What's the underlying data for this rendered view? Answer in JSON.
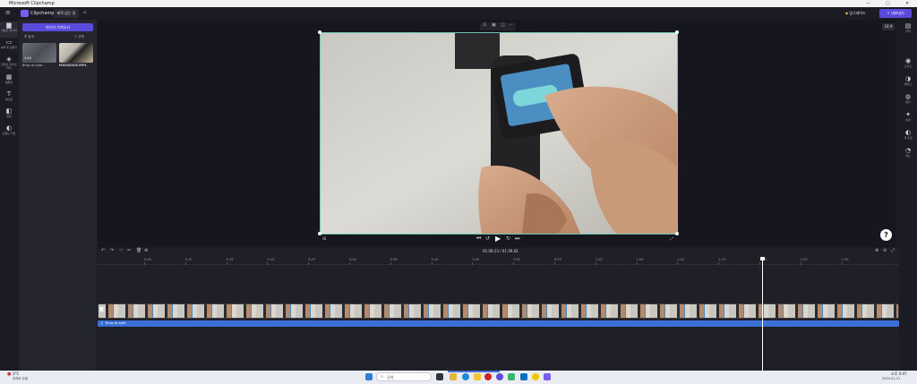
{
  "window": {
    "title": "Microsoft Clipchamp",
    "minimize": "—",
    "maximize": "▢",
    "close": "✕"
  },
  "appbar": {
    "logo_text": "Clipchamp",
    "project_title": "제목 없는 동",
    "upgrade_label": "업그레이드",
    "export_label": "내보내기"
  },
  "left_rail": [
    {
      "icon": "folder-icon",
      "glyph": "▆",
      "label": "사용자 미디어"
    },
    {
      "icon": "record-icon",
      "glyph": "▭",
      "label": "녹화 및 만들기"
    },
    {
      "icon": "content-library-icon",
      "glyph": "◈",
      "label": "콘텐츠 라이브러리"
    },
    {
      "icon": "templates-icon",
      "glyph": "▦",
      "label": "템플릿"
    },
    {
      "icon": "text-icon",
      "glyph": "T",
      "label": "텍스트"
    },
    {
      "icon": "transitions-icon",
      "glyph": "◧",
      "label": "전환"
    },
    {
      "icon": "brand-kit-icon",
      "glyph": "◐",
      "label": "브랜드 키트"
    }
  ],
  "media_panel": {
    "import_label": "미디어 가져오기",
    "filter_label": "검색",
    "select_label": "선택",
    "items": [
      {
        "name": "Brng ds byte...",
        "duration": "1:40"
      },
      {
        "name": "MA045026.MP4",
        "duration": ""
      }
    ]
  },
  "preview": {
    "aspect_label": "16:9",
    "help_label": "?",
    "timecode": "01:09.13 / 01:39.62"
  },
  "right_rail": [
    {
      "icon": "captions-icon",
      "glyph": "▤",
      "label": "자막"
    },
    {
      "icon": "audio-icon",
      "glyph": "◉",
      "label": "오디오"
    },
    {
      "icon": "fade-icon",
      "glyph": "◑",
      "label": "페이드"
    },
    {
      "icon": "filters-icon",
      "glyph": "◍",
      "label": "필터"
    },
    {
      "icon": "effects-icon",
      "glyph": "✦",
      "label": "효과"
    },
    {
      "icon": "color-icon",
      "glyph": "◐",
      "label": "색 조정"
    },
    {
      "icon": "speed-icon",
      "glyph": "◔",
      "label": "속도"
    }
  ],
  "timeline": {
    "ticks": [
      "0:05",
      "0:10",
      "0:15",
      "0:20",
      "0:25",
      "0:30",
      "0:35",
      "0:40",
      "0:45",
      "0:50",
      "0:55",
      "1:00",
      "1:05",
      "1:10",
      "1:15",
      "1:20",
      "1:25",
      "1:30"
    ],
    "playhead_label": "1:09",
    "audio_track_label": "Brng ds byte"
  },
  "taskbar": {
    "weather": "3°C",
    "weather_sub": "대체로 흐림",
    "search_placeholder": "검색",
    "time": "오후 4:47",
    "date": "2024-01-21"
  },
  "colors": {
    "accent": "#5b4bdb",
    "selection_border": "#6ec6b8",
    "audio_track": "#3a6fd8",
    "playhead": "#ffffff"
  }
}
